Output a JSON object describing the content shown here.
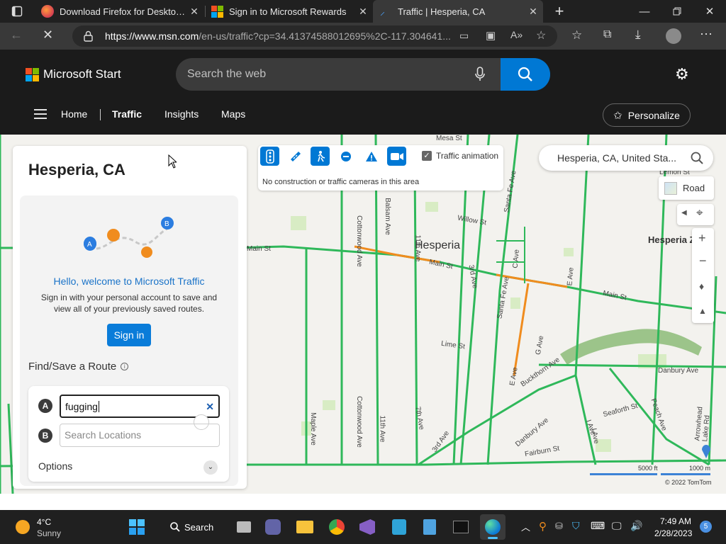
{
  "browser": {
    "tabs": [
      {
        "title": "Download Firefox for Desktop — "
      },
      {
        "title": "Sign in to Microsoft Rewards"
      },
      {
        "title": "Traffic | Hesperia, CA"
      }
    ],
    "url_host": "https://www.msn.com",
    "url_rest": "/en-us/traffic?cp=34.41374588012695%2C-117.304641..."
  },
  "site": {
    "brand": "Microsoft Start",
    "search_placeholder": "Search the web",
    "nav": [
      "Home",
      "Traffic",
      "Insights",
      "Maps"
    ],
    "personalize": "Personalize"
  },
  "panel": {
    "title": "Hesperia, CA",
    "welcome": "Hello, welcome to Microsoft Traffic",
    "desc": "Sign in with your personal account to save and view all of your previously saved routes.",
    "signin": "Sign in",
    "find_save": "Find/Save a Route",
    "point_a": "A",
    "point_b": "B",
    "input_a_value": "fugging",
    "input_b_placeholder": "Search Locations",
    "options": "Options"
  },
  "toolbar": {
    "animation_label": "Traffic animation",
    "status": "No construction or traffic cameras in this area"
  },
  "map": {
    "search_value": "Hesperia, CA, United Sta...",
    "style": "Road",
    "city": "Hesperia",
    "city_edge": "Hesperia Z",
    "scale_ft": "5000 ft",
    "scale_m": "1000 m",
    "copyright": "© 2022 TomTom",
    "streets": [
      "Mesa St",
      "Willow St",
      "Main St",
      "Main St",
      "Main St",
      "Lime St",
      "Danbury Ave",
      "Seaforth St",
      "Fairburn St",
      "Lemon St",
      "Cottonwood Ave",
      "Cottonwood Ave",
      "Balsam Ave",
      "11th Ave",
      "11th Ave",
      "3rd Ave",
      "Santa Fe Ave",
      "Santa Fe Ave",
      "C Ave",
      "E Ave",
      "E Ave",
      "G Ave",
      "I Ave",
      "Maple Ave",
      "7th Ave",
      "3rd Ave",
      "Danbury Ave",
      "Buckthorn Ave",
      "Peach Ave",
      "I Ave",
      "Arrowhead Lake Rd"
    ]
  },
  "taskbar": {
    "temp": "4°C",
    "weather": "Sunny",
    "search": "Search",
    "time": "7:49 AM",
    "date": "2/28/2023",
    "badge": "5"
  }
}
